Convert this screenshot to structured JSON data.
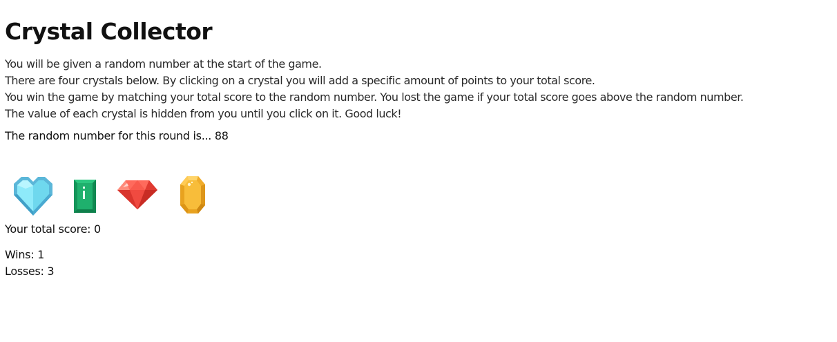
{
  "page": {
    "title": "Crystal Collector"
  },
  "instructions": [
    "You will be given a random number at the start of the game.",
    "There are four crystals below. By clicking on a crystal you will add a specific amount of points to your total score.",
    "You win the game by matching your total score to the random number. You lost the game if your total score goes above the random number.",
    "The value of each crystal is hidden from you until you click on it. Good luck!"
  ],
  "target": {
    "label": "The random number for this round is...",
    "value": "88"
  },
  "crystals": [
    {
      "name": "blue-heart-crystal-icon",
      "color": "#6fd8ee"
    },
    {
      "name": "green-emerald-crystal-icon",
      "color": "#1fa567"
    },
    {
      "name": "red-ruby-crystal-icon",
      "color": "#e8453c"
    },
    {
      "name": "yellow-topaz-crystal-icon",
      "color": "#f5b731"
    }
  ],
  "score": {
    "label": "Your total score:",
    "value": "0"
  },
  "stats": {
    "wins_label": "Wins:",
    "wins": "1",
    "losses_label": "Losses:",
    "losses": "3"
  }
}
